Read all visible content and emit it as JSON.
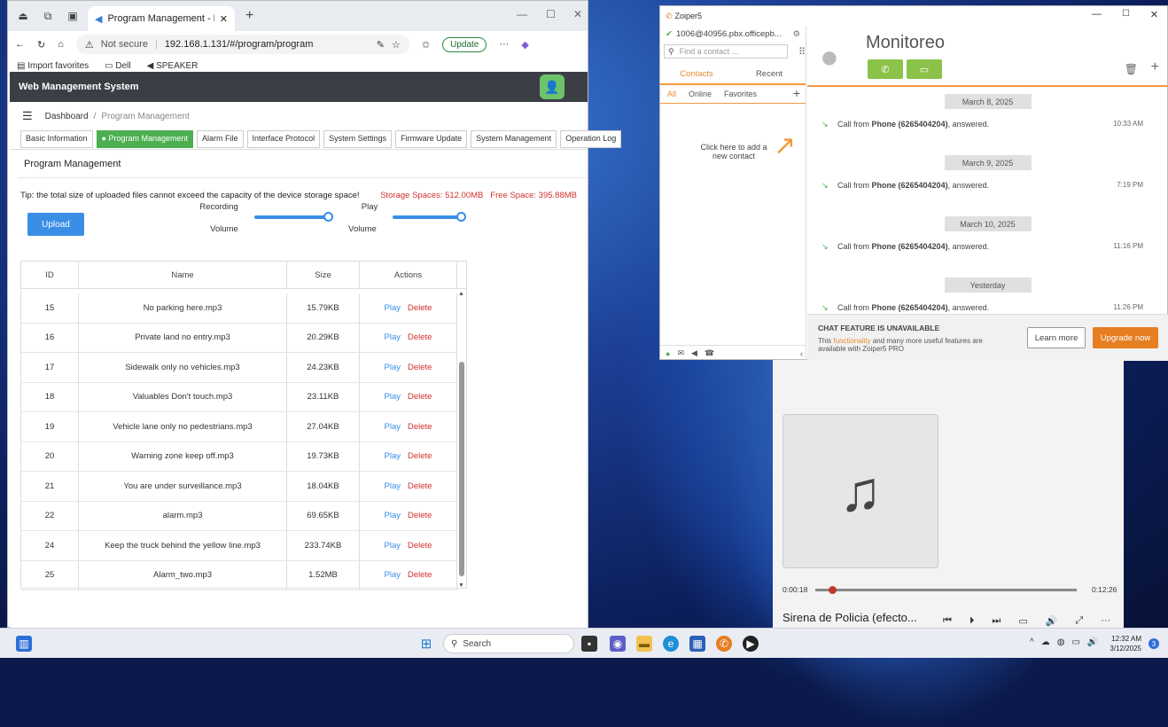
{
  "browser": {
    "tab_title": "Program Management - Network",
    "security": "Not secure",
    "url": "192.168.1.131/#/program/program",
    "update_label": "Update",
    "favorites": [
      "Import favorites",
      "Dell",
      "SPEAKER"
    ]
  },
  "app": {
    "title": "Web Management System",
    "breadcrumb": {
      "home": "Dashboard",
      "separator": "/",
      "current": "Program Management"
    },
    "tabs": [
      "Basic Information",
      "Program Management",
      "Alarm File",
      "Interface Protocol",
      "System Settings",
      "Firmware Update",
      "System Management",
      "Operation Log"
    ],
    "active_tab": 1,
    "section_title": "Program Management",
    "tip": "Tip: the total size of uploaded files cannot exceed the capacity of the device storage space!",
    "storage": "Storage Spaces: 512.00MB",
    "free": "Free Space: 395.88MB",
    "upload_label": "Upload",
    "recording_label": "Recording",
    "recording_volume_label": "Volume",
    "play_label": "Play",
    "play_volume_label": "Volume",
    "recording_volume": 1.0,
    "play_volume": 1.0,
    "table": {
      "headers": [
        "ID",
        "Name",
        "Size",
        "Actions"
      ],
      "play_label": "Play",
      "delete_label": "Delete",
      "rows": [
        {
          "id": "15",
          "name": "No parking here.mp3",
          "size": "15.79KB"
        },
        {
          "id": "16",
          "name": "Private land no entry.mp3",
          "size": "20.29KB"
        },
        {
          "id": "17",
          "name": "Sidewalk only no vehicles.mp3",
          "size": "24.23KB"
        },
        {
          "id": "18",
          "name": "Valuables Don't touch.mp3",
          "size": "23.11KB"
        },
        {
          "id": "19",
          "name": "Vehicle lane only no pedestrians.mp3",
          "size": "27.04KB"
        },
        {
          "id": "20",
          "name": "Warning zone keep off.mp3",
          "size": "19.73KB"
        },
        {
          "id": "21",
          "name": "You are under surveillance.mp3",
          "size": "18.04KB"
        },
        {
          "id": "22",
          "name": "alarm.mp3",
          "size": "69.65KB"
        },
        {
          "id": "24",
          "name": "Keep the truck behind the yellow line.mp3",
          "size": "233.74KB"
        },
        {
          "id": "25",
          "name": "Alarm_two.mp3",
          "size": "1.52MB"
        }
      ]
    }
  },
  "zoiper": {
    "title": "Zoiper5",
    "account": "1006@40956.pbx.officepb...",
    "search_placeholder": "Find a contact ...",
    "tab_contacts": "Contacts",
    "tab_recent": "Recent",
    "filter_all": "All",
    "filter_online": "Online",
    "filter_favorites": "Favorites",
    "add_contact_hint": "Click here to add a new contact",
    "contact_name": "Monitoreo",
    "history": [
      {
        "date": "March 8, 2025",
        "prefix": "Call from ",
        "caller": "Phone (6265404204)",
        "suffix": ", answered.",
        "time": "10:33 AM"
      },
      {
        "date": "March 9, 2025",
        "prefix": "Call from ",
        "caller": "Phone (6265404204)",
        "suffix": ", answered.",
        "time": "7:19 PM"
      },
      {
        "date": "March 10, 2025",
        "prefix": "Call from ",
        "caller": "Phone (6265404204)",
        "suffix": ", answered.",
        "time": "11:16 PM"
      },
      {
        "date": "Yesterday",
        "prefix": "Call from ",
        "caller": "Phone (6265404204)",
        "suffix": ", answered.",
        "time": "11:26 PM"
      }
    ],
    "chat_heading": "CHAT FEATURE IS UNAVAILABLE",
    "chat_desc_1": "This ",
    "chat_desc_link": "functionality",
    "chat_desc_2": " and many more useful features are available with Zoiper5 PRO",
    "learn_more": "Learn more",
    "upgrade": "Upgrade now"
  },
  "media": {
    "elapsed": "0:00:18",
    "duration": "0:12:26",
    "title": "Sirena de Policia (efecto...",
    "progress": 0.024
  },
  "taskbar": {
    "search_label": "Search",
    "time": "12:32 AM",
    "date": "3/12/2025",
    "notifications": "3"
  }
}
